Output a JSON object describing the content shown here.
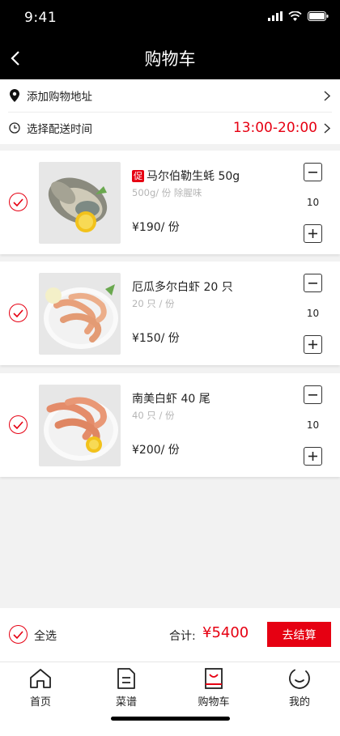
{
  "status_bar": {
    "time": "9:41"
  },
  "nav": {
    "title": "购物车"
  },
  "address": {
    "add_label": "添加购物地址",
    "time_label": "选择配送时间",
    "time_value": "13:00-20:00"
  },
  "items": [
    {
      "promo": "促",
      "name": "马尔伯勒生蚝 50g",
      "spec": "500g/ 份  除腥味",
      "price": "¥190/ 份",
      "qty": "10"
    },
    {
      "promo": "",
      "name": "厄瓜多尔白虾 20 只",
      "spec": "20 只 / 份",
      "price": "¥150/ 份",
      "qty": "10"
    },
    {
      "promo": "",
      "name": "南美白虾 40 尾",
      "spec": "40 只 / 份",
      "price": "¥200/ 份",
      "qty": "10"
    }
  ],
  "checkout": {
    "select_all": "全选",
    "total_label": "合计:",
    "total_value": "¥5400",
    "checkout_label": "去结算"
  },
  "tabs": [
    {
      "label": "首页",
      "icon": "home-icon"
    },
    {
      "label": "菜谱",
      "icon": "recipe-icon"
    },
    {
      "label": "购物车",
      "icon": "cart-icon"
    },
    {
      "label": "我的",
      "icon": "profile-icon"
    }
  ],
  "colors": {
    "accent": "#e60012",
    "header_bg": "#000000",
    "page_bg": "#f2f2f2"
  }
}
